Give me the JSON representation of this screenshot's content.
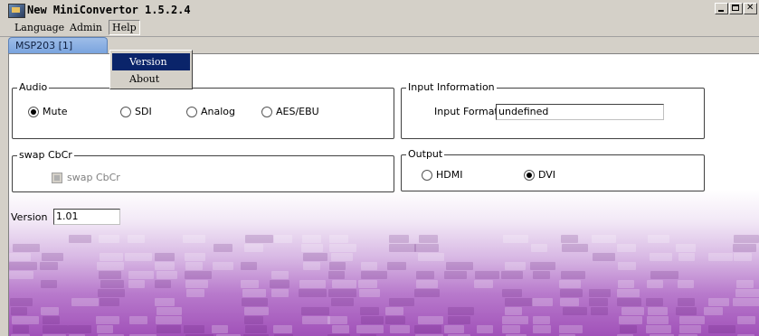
{
  "window": {
    "title": "New MiniConvertor 1.5.2.4"
  },
  "menu": {
    "language": "Language",
    "admin": "Admin",
    "help": "Help",
    "help_items": [
      "Version",
      "About"
    ]
  },
  "tab": {
    "label": "MSP203 [1]"
  },
  "audio": {
    "title": "Audio",
    "options": [
      "Mute",
      "SDI",
      "Analog",
      "AES/EBU"
    ],
    "selected": "Mute"
  },
  "input_info": {
    "title": "Input Information",
    "format_label": "Input Format",
    "format_value": "undefined"
  },
  "swap": {
    "title": "swap CbCr",
    "checkbox_label": "swap CbCr"
  },
  "output": {
    "title": "Output",
    "options": [
      "HDMI",
      "DVI"
    ],
    "selected": "DVI"
  },
  "version": {
    "label": "Version",
    "value": "1.01"
  },
  "colors": {
    "menu_highlight": "#0a246a",
    "tab": "#8fb2e3",
    "background_purple": "#a050b8"
  }
}
